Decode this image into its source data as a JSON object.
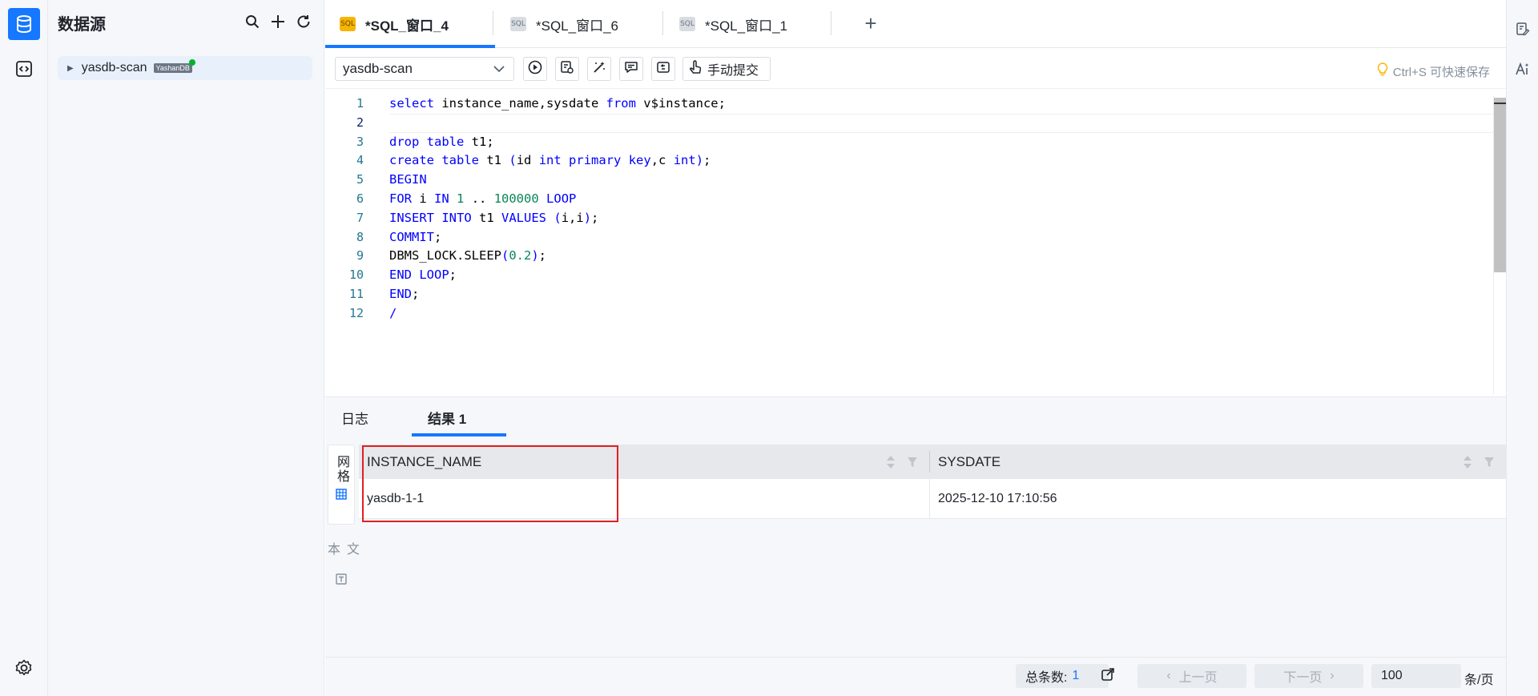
{
  "datasource": {
    "title": "数据源",
    "node_name": "yasdb-scan",
    "node_badge": "YashanDB"
  },
  "tabs": [
    {
      "label": "*SQL_窗口_4",
      "icon": "SQL",
      "active": true
    },
    {
      "label": "*SQL_窗口_6",
      "icon": "SQL",
      "active": false
    },
    {
      "label": "*SQL_窗口_1",
      "icon": "SQL",
      "active": false
    }
  ],
  "toolbar": {
    "db_selected": "yasdb-scan",
    "commit_label": "手动提交",
    "hint": "Ctrl+S 可快速保存"
  },
  "editor": {
    "line_numbers": [
      "1",
      "2",
      "3",
      "4",
      "5",
      "6",
      "7",
      "8",
      "9",
      "10",
      "11",
      "12"
    ],
    "lines": [
      "select instance_name,sysdate from v$instance;",
      "",
      "drop table t1;",
      "create table t1 (id int primary key,c int);",
      "BEGIN",
      "FOR i IN 1 .. 100000 LOOP",
      "INSERT INTO t1 VALUES (i,i);",
      "COMMIT;",
      "DBMS_LOCK.SLEEP(0.2);",
      "END LOOP;",
      "END;",
      "/"
    ]
  },
  "results": {
    "tabs": [
      "日志",
      "结果 1"
    ],
    "active_tab": "结果 1",
    "view_tabs": [
      "网格",
      "文本"
    ],
    "columns": [
      "INSTANCE_NAME",
      "SYSDATE"
    ],
    "rows": [
      [
        "yasdb-1-1",
        "2025-12-10 17:10:56"
      ]
    ]
  },
  "footer": {
    "total_label": "总条数:",
    "total_value": "1",
    "prev_label": "上一页",
    "next_label": "下一页",
    "page_size": "100",
    "page_unit": "条/页"
  },
  "colors": {
    "accent": "#1677ff",
    "highlight_box": "#e02020",
    "online_dot": "#00b42a"
  },
  "icons": {
    "rail": [
      "database-icon",
      "code-icon",
      "gear-icon"
    ],
    "datasource_actions": [
      "search-icon",
      "plus-icon",
      "refresh-icon"
    ],
    "toolbar": [
      "run-icon",
      "explain-icon",
      "format-icon",
      "comment-icon",
      "history-icon",
      "hand-icon"
    ],
    "right_rail": [
      "edit-doc-icon",
      "ai-icon"
    ]
  }
}
